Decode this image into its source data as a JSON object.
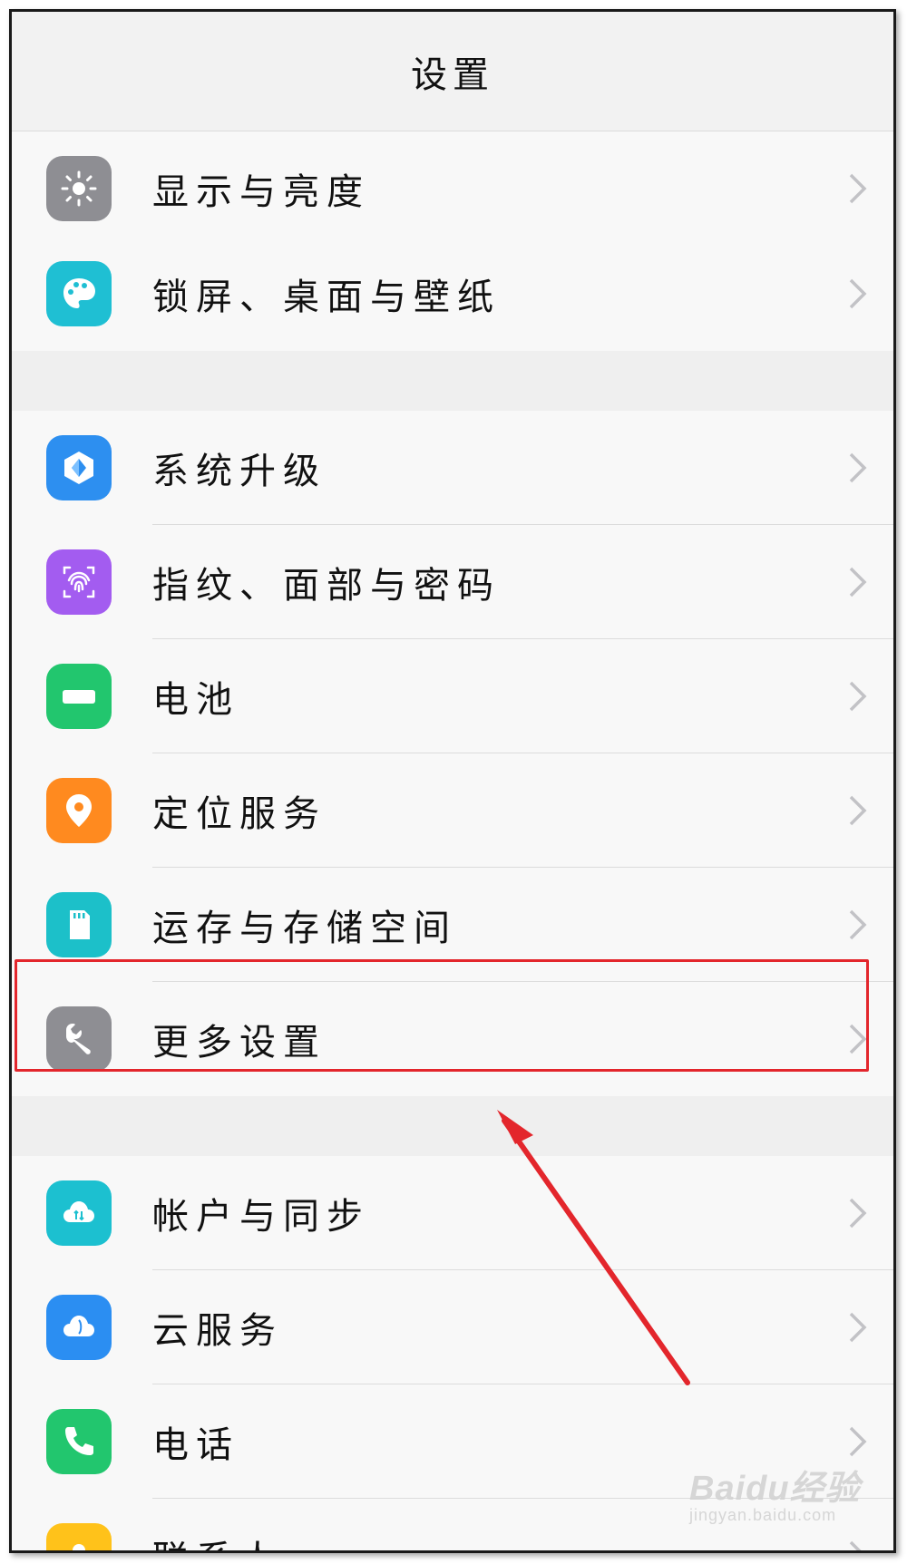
{
  "header": {
    "title": "设置"
  },
  "rows": [
    {
      "label": "显示与亮度",
      "icon": "sun-icon",
      "color": "#8e8e93"
    },
    {
      "label": "锁屏、桌面与壁纸",
      "icon": "palette-icon",
      "color": "#1fbfd3"
    },
    {
      "label": "系统升级",
      "icon": "upgrade-cube-icon",
      "color": "#2d8ff0"
    },
    {
      "label": "指纹、面部与密码",
      "icon": "fingerprint-icon",
      "color": "#a35cf0"
    },
    {
      "label": "电池",
      "icon": "battery-icon",
      "color": "#22c66e"
    },
    {
      "label": "定位服务",
      "icon": "location-pin-icon",
      "color": "#ff8a1f"
    },
    {
      "label": "运存与存储空间",
      "icon": "sd-card-icon",
      "color": "#1cc0c9"
    },
    {
      "label": "更多设置",
      "icon": "wrench-icon",
      "color": "#8e8e93"
    },
    {
      "label": "帐户与同步",
      "icon": "cloud-sync-icon",
      "color": "#1cc0d0"
    },
    {
      "label": "云服务",
      "icon": "cloud-icon",
      "color": "#2b8ef2"
    },
    {
      "label": "电话",
      "icon": "phone-icon",
      "color": "#22c66e"
    },
    {
      "label": "联系人",
      "icon": "contact-icon",
      "color": "#ffc21a"
    }
  ],
  "annotation": {
    "highlight_color": "#e3262c",
    "highlighted_item": "更多设置"
  },
  "watermark": {
    "logo": "Baidu经验",
    "url": "jingyan.baidu.com"
  }
}
